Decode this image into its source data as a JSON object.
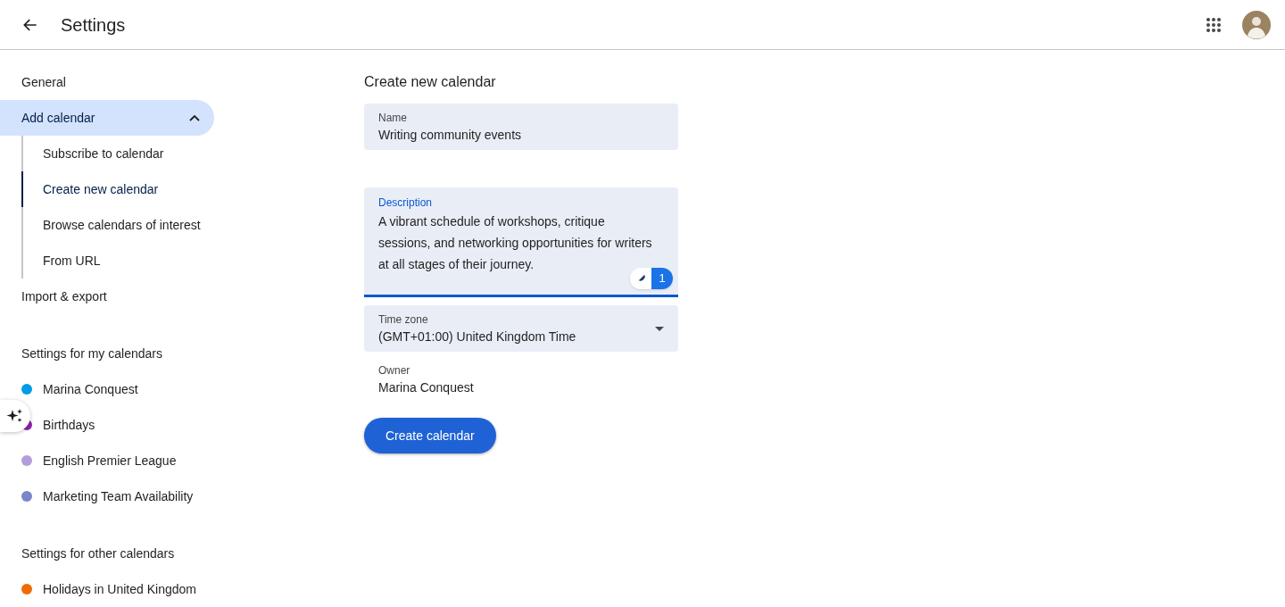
{
  "header": {
    "title": "Settings"
  },
  "nav": [
    {
      "label": "General",
      "selected": false
    },
    {
      "label": "Add calendar",
      "selected": true,
      "expanded": true,
      "children": [
        {
          "label": "Subscribe to calendar",
          "selected": false
        },
        {
          "label": "Create new calendar",
          "selected": true
        },
        {
          "label": "Browse calendars of interest",
          "selected": false
        },
        {
          "label": "From URL",
          "selected": false
        }
      ]
    },
    {
      "label": "Import & export",
      "selected": false
    }
  ],
  "my_calendars": {
    "title": "Settings for my calendars",
    "items": [
      {
        "label": "Marina Conquest",
        "color": "#039be5"
      },
      {
        "label": "Birthdays",
        "color": "#8e24aa"
      },
      {
        "label": "English Premier League",
        "color": "#b39ddb"
      },
      {
        "label": "Marketing Team Availability",
        "color": "#7986cb"
      }
    ]
  },
  "other_calendars": {
    "title": "Settings for other calendars",
    "items": [
      {
        "label": "Holidays in United Kingdom",
        "color": "#ef6c00"
      }
    ]
  },
  "form": {
    "title": "Create new calendar",
    "name": {
      "label": "Name",
      "value": "Writing community events"
    },
    "description": {
      "label": "Description",
      "value": "A vibrant schedule of workshops, critique sessions, and networking opportunities for writers at all stages of their journey.",
      "focused": true,
      "suggestions": "1"
    },
    "time_zone": {
      "label": "Time zone",
      "value": "(GMT+01:00) United Kingdom Time"
    },
    "owner": {
      "label": "Owner",
      "value": "Marina Conquest"
    },
    "submit": "Create calendar"
  }
}
